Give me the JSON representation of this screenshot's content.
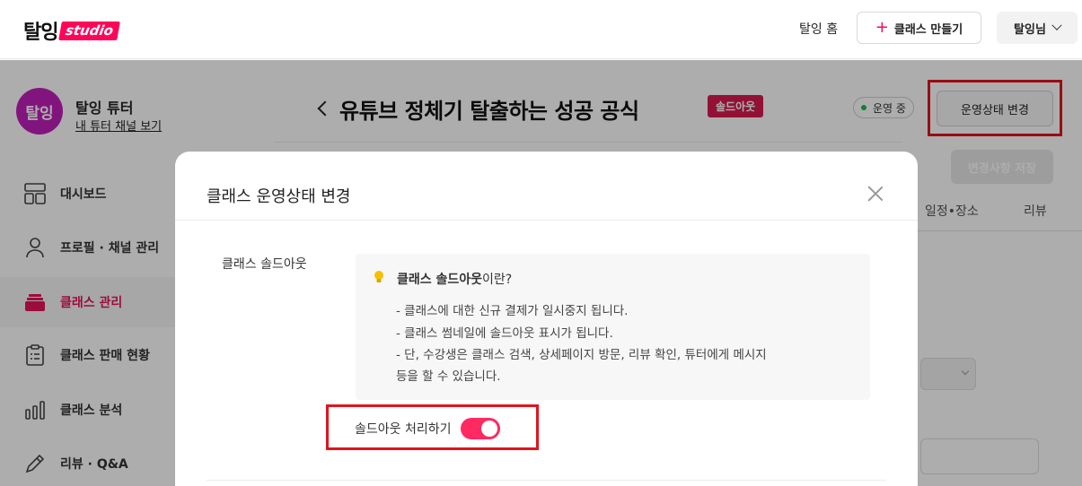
{
  "topbar": {
    "logo_word": "탈잉",
    "logo_studio": "studio",
    "home_link": "탈잉 홈",
    "create_button": "클래스 만들기",
    "user_button": "탈잉님"
  },
  "sidebar": {
    "avatar_text": "탈잉",
    "profile_name": "탈잉 튜터",
    "profile_link": "내 튜터 채널 보기",
    "items": [
      {
        "label": "대시보드",
        "icon": "dashboard-icon"
      },
      {
        "label": "프로필 · 채널 관리",
        "icon": "person-icon"
      },
      {
        "label": "클래스 관리",
        "icon": "class-stack-icon",
        "active": true
      },
      {
        "label": "클래스 판매 현황",
        "icon": "clipboard-icon"
      },
      {
        "label": "클래스 분석",
        "icon": "bar-chart-icon"
      },
      {
        "label": "리뷰 · Q&A",
        "icon": "pencil-icon"
      }
    ]
  },
  "main": {
    "page_title": "유튜브 정체기 탈출하는 성공 공식",
    "soldout_badge": "솔드아웃",
    "status_pill": "운영 중",
    "change_status_button": "운영상태 변경",
    "save_button": "변경사항 저장",
    "tabs": [
      "일정•장소",
      "리뷰"
    ]
  },
  "modal": {
    "title": "클래스 운영상태 변경",
    "field_label": "클래스 솔드아웃",
    "info_title_bold": "클래스 솔드아웃",
    "info_title_rest": "이란?",
    "info_lines": [
      "- 클래스에 대한 신규 결제가 일시중지 됩니다.",
      "- 클래스 썸네일에 솔드아웃 표시가 됩니다.",
      "- 단, 수강생은 클래스 검색, 상세페이지 방문, 리뷰 확인, 튜터에게 메시지",
      "등을 할 수 있습니다."
    ],
    "toggle_label": "솔드아웃 처리하기",
    "toggle_on": true
  },
  "colors": {
    "brand": "#ff0558",
    "badge": "#d81b50",
    "active_nav": "#e6125a",
    "status_dot": "#1db954",
    "highlight_box": "#e1141e"
  }
}
